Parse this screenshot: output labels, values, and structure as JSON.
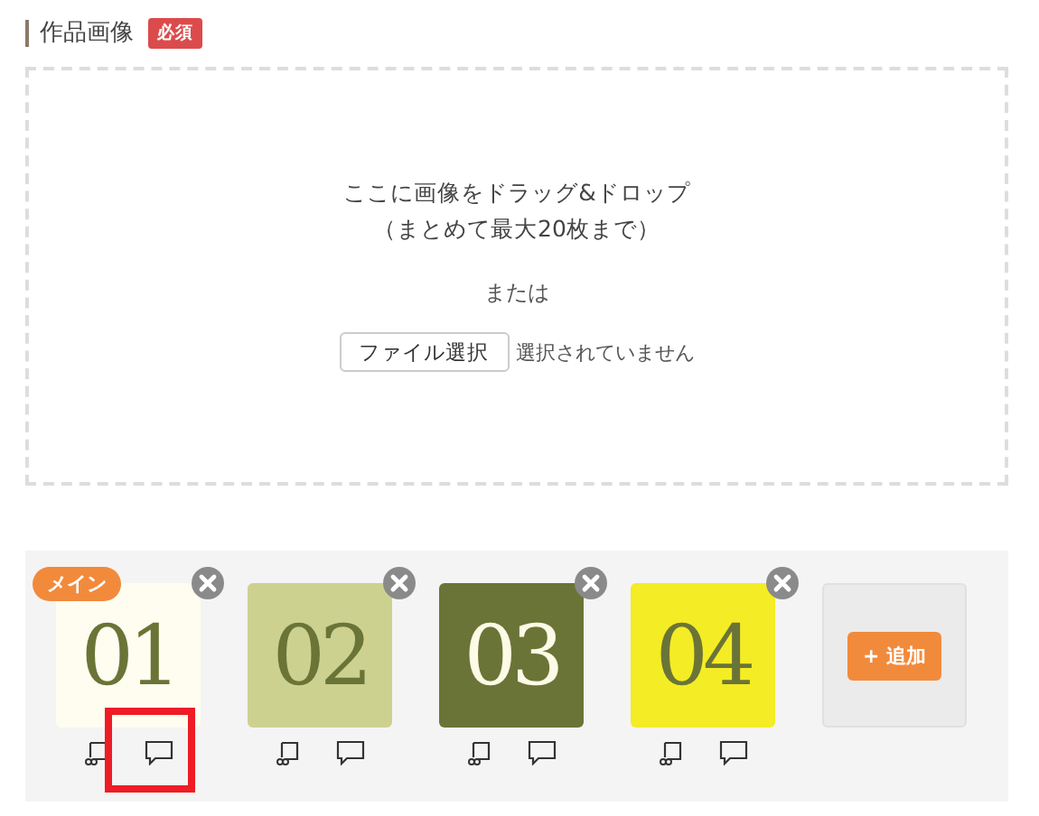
{
  "heading": {
    "label": "作品画像",
    "badge": "必須"
  },
  "dropzone": {
    "line1": "ここに画像をドラッグ&ドロップ",
    "line2": "（まとめて最大20枚まで）",
    "or": "または",
    "file_button": "ファイル選択",
    "file_status": "選択されていません"
  },
  "thumbnails": [
    {
      "label": "01",
      "color": "#fefdf0",
      "kind": "light",
      "main_badge": "メイン",
      "highlighted": true
    },
    {
      "label": "02",
      "color": "#cdd190",
      "kind": "light",
      "highlighted": false
    },
    {
      "label": "03",
      "color": "#6b7437",
      "kind": "dark",
      "highlighted": false
    },
    {
      "label": "04",
      "color": "#f4ec24",
      "kind": "light",
      "highlighted": false
    }
  ],
  "add_button": "+ 追加"
}
